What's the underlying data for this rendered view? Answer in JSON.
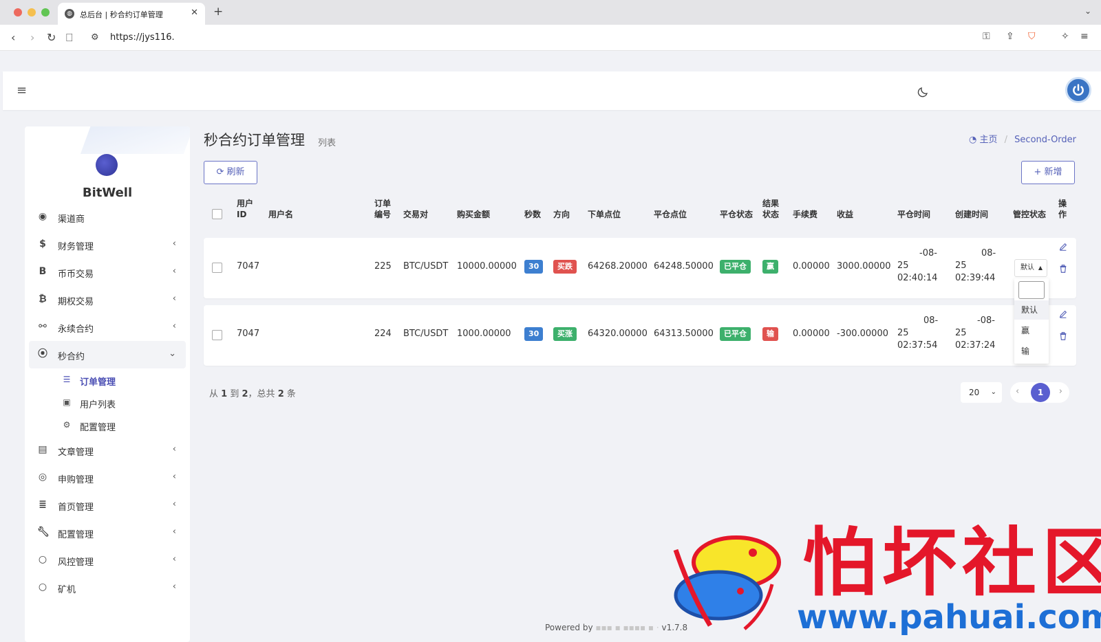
{
  "browser": {
    "tab_title": "总后台 | 秒合约订单管理",
    "url": "https://jys116."
  },
  "brand": {
    "name": "BitWell"
  },
  "sidebar": {
    "items": [
      {
        "label": "渠道商",
        "icon": "user-circle-icon",
        "has_chevron": false
      },
      {
        "label": "财务管理",
        "icon": "dollar-icon",
        "has_chevron": true
      },
      {
        "label": "币币交易",
        "icon": "b-icon",
        "has_chevron": true
      },
      {
        "label": "期权交易",
        "icon": "bitcoin-icon",
        "has_chevron": true
      },
      {
        "label": "永续合约",
        "icon": "link-icon",
        "has_chevron": true
      },
      {
        "label": "秒合约",
        "icon": "dot-circle-icon",
        "has_chevron": true,
        "expanded": true
      }
    ],
    "sub_items": [
      {
        "label": "订单管理",
        "icon": "list-icon",
        "active": true
      },
      {
        "label": "用户列表",
        "icon": "contact-icon",
        "active": false
      },
      {
        "label": "配置管理",
        "icon": "gear-icon",
        "active": false
      }
    ],
    "items_after": [
      {
        "label": "文章管理",
        "icon": "newspaper-icon"
      },
      {
        "label": "申购管理",
        "icon": "lifebuoy-icon"
      },
      {
        "label": "首页管理",
        "icon": "bars-icon"
      },
      {
        "label": "配置管理",
        "icon": "wrench-icon"
      },
      {
        "label": "风控管理",
        "icon": "circle-icon"
      },
      {
        "label": "矿机",
        "icon": "circle-icon"
      }
    ]
  },
  "page": {
    "title": "秒合约订单管理",
    "subtitle": "列表",
    "breadcrumb_home": "主页",
    "breadcrumb_current": "Second-Order",
    "refresh_label": "刷新",
    "add_label": "新增"
  },
  "table": {
    "headers": {
      "user_id": "用户\nID",
      "username": "用户名",
      "order_no": "订单\n编号",
      "pair": "交易对",
      "amount": "购买金额",
      "seconds": "秒数",
      "direction": "方向",
      "open_price": "下单点位",
      "close_price": "平仓点位",
      "close_status": "平仓状态",
      "result_status": "结果\n状态",
      "fee": "手续费",
      "profit": "收益",
      "close_time": "平仓时间",
      "create_time": "创建时间",
      "control": "管控状态",
      "ops": "操\n作"
    },
    "rows": [
      {
        "user_id": "7047",
        "order_no": "225",
        "pair": "BTC/USDT",
        "amount": "10000.00000",
        "seconds": "30",
        "direction": "买跌",
        "open_price": "64268.20000",
        "close_price": "64248.50000",
        "close_status": "已平仓",
        "result": "赢",
        "fee": "0.00000",
        "profit": "3000.00000",
        "close_time_l1": "-08-",
        "close_time_l2": "25",
        "close_time_l3": "02:40:14",
        "create_time_l1": "08-",
        "create_time_l2": "25",
        "create_time_l3": "02:39:44"
      },
      {
        "user_id": "7047",
        "order_no": "224",
        "pair": "BTC/USDT",
        "amount": "1000.00000",
        "seconds": "30",
        "direction": "买涨",
        "open_price": "64320.00000",
        "close_price": "64313.50000",
        "close_status": "已平仓",
        "result": "输",
        "fee": "0.00000",
        "profit": "-300.00000",
        "close_time_l1": "08-",
        "close_time_l2": "25",
        "close_time_l3": "02:37:54",
        "create_time_l1": "-08-",
        "create_time_l2": "25",
        "create_time_l3": "02:37:24"
      }
    ],
    "control_select": {
      "value": "默认",
      "options": [
        "默认",
        "赢",
        "输"
      ]
    }
  },
  "pagination": {
    "info_prefix": "从",
    "from": "1",
    "to_word": "到",
    "to": "2",
    "total_word": "，总共",
    "total": "2",
    "unit": "条",
    "page_size": "20",
    "current_page": "1"
  },
  "footer": {
    "powered": "Powered by",
    "version": "v1.7.8"
  },
  "watermark": {
    "cn_text": "怕坏社区",
    "url_text": "www.pahuai.com"
  },
  "colors": {
    "accent": "#5a5fd0",
    "badge_blue": "#3d7fd0",
    "badge_red": "#e0524f",
    "badge_green": "#3db06c"
  }
}
